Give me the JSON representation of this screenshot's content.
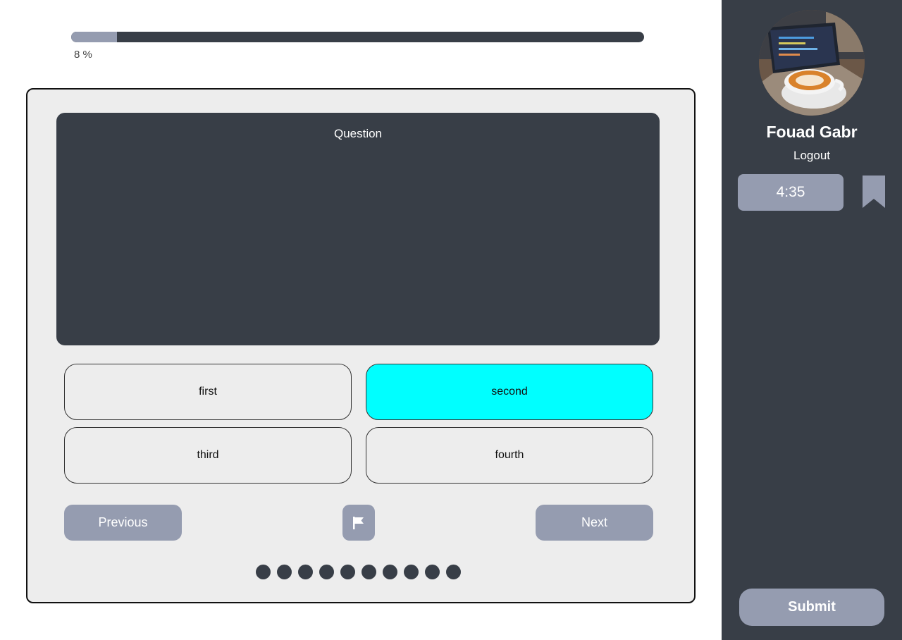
{
  "progress": {
    "value_percent": 8,
    "label": "8 %"
  },
  "question": {
    "title": "Question"
  },
  "answers": [
    {
      "label": "first",
      "selected": false
    },
    {
      "label": "second",
      "selected": true
    },
    {
      "label": "third",
      "selected": false
    },
    {
      "label": "fourth",
      "selected": false
    }
  ],
  "navigation": {
    "previous_label": "Previous",
    "next_label": "Next",
    "flag_icon": "flag-icon",
    "question_dots_count": 10
  },
  "sidebar": {
    "avatar_image": "coffee-laptop-photo",
    "user_name": "Fouad Gabr",
    "logout_label": "Logout",
    "timer": "4:35",
    "bookmark_icon": "bookmark-icon",
    "submit_label": "Submit"
  },
  "colors": {
    "dark": "#383e47",
    "accent": "#959cb0",
    "selected": "#00ffff",
    "card": "#ededed"
  }
}
